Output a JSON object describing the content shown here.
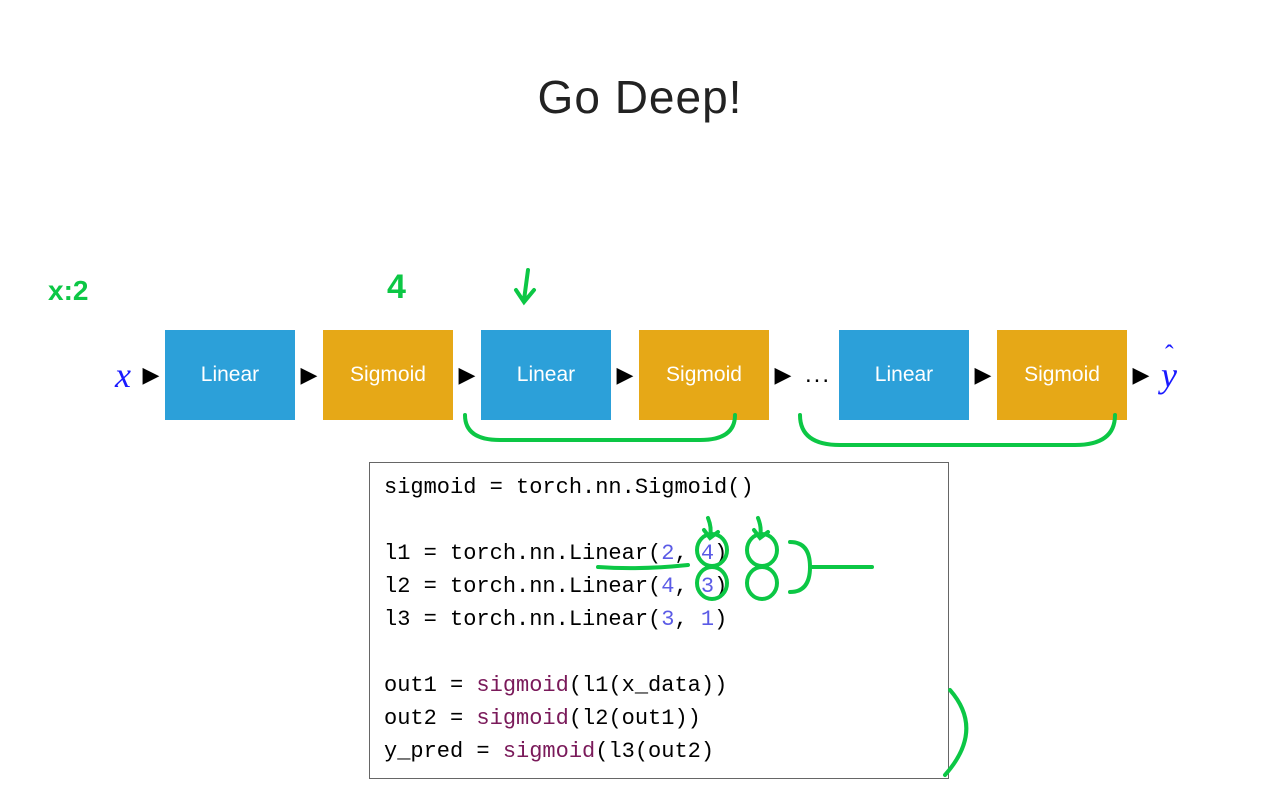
{
  "title": "Go Deep!",
  "input_symbol": "x",
  "output_symbol": "y",
  "output_hat": "ˆ",
  "ellipsis": "...",
  "boxes": {
    "linear": "Linear",
    "sigmoid": "Sigmoid"
  },
  "code": {
    "l0": "sigmoid = torch.nn.Sigmoid()",
    "l1a": "l1 = torch.nn.Linear(",
    "l1b": "2",
    "l1c": ", ",
    "l1d": "4",
    "l1e": ")",
    "l2a": "l2 = torch.nn.Linear(",
    "l2b": "4",
    "l2c": ", ",
    "l2d": "3",
    "l2e": ")",
    "l3a": "l3 = torch.nn.Linear(",
    "l3b": "3",
    "l3c": ", ",
    "l3d": "1",
    "l3e": ")",
    "l4a": "out1   = ",
    "l4b": "sigmoid",
    "l4c": "(l1(x_data))",
    "l5a": "out2   = ",
    "l5b": "sigmoid",
    "l5c": "(l2(out1))",
    "l6a": "y_pred = ",
    "l6b": "sigmoid",
    "l6c": "(l3(out2)"
  },
  "annotations": {
    "x_label": "x:2",
    "four": "4"
  }
}
